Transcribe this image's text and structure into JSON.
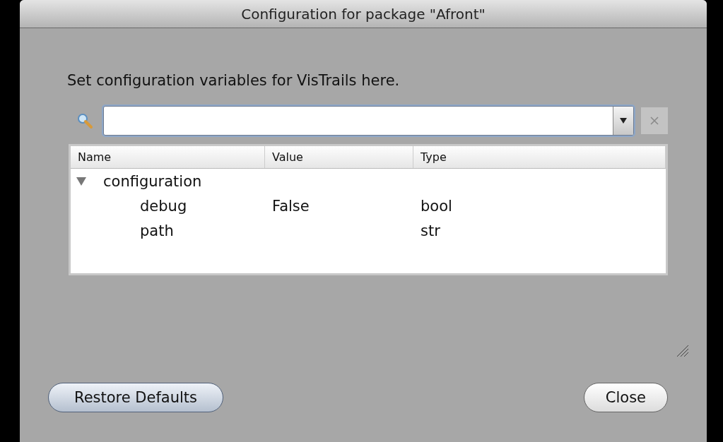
{
  "window": {
    "title": "Configuration for package \"Afront\""
  },
  "description": "Set configuration variables for VisTrails here.",
  "table": {
    "columns": [
      "Name",
      "Value",
      "Type"
    ],
    "rows": [
      {
        "name": "configuration",
        "expanded": true,
        "children": [
          {
            "name": "debug",
            "value": "False",
            "type": "bool"
          },
          {
            "name": "path",
            "type": "str"
          }
        ]
      }
    ]
  },
  "buttons": {
    "restore": "Restore Defaults",
    "close": "Close"
  }
}
